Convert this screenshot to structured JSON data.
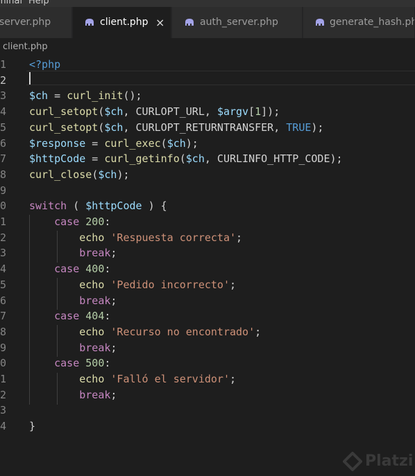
{
  "menubar": {
    "items": [
      "minal",
      "Help"
    ]
  },
  "tabs": [
    {
      "label": "server.php",
      "active": false,
      "icon": "php-elephant-icon"
    },
    {
      "label": "client.php",
      "active": true,
      "icon": "php-elephant-icon",
      "close": "×"
    },
    {
      "label": "auth_server.php",
      "active": false,
      "icon": "php-elephant-icon"
    },
    {
      "label": "generate_hash.php",
      "active": false,
      "icon": "php-elephant-icon"
    }
  ],
  "breadcrumb": "client.php",
  "editor": {
    "active_line": 2,
    "lines": [
      {
        "n": "1",
        "tokens": [
          [
            "<?php",
            "#569cd6"
          ]
        ]
      },
      {
        "n": "2",
        "tokens": []
      },
      {
        "n": "3",
        "tokens": [
          [
            "$ch",
            "#9cdcfe"
          ],
          [
            " = ",
            "#d4d4d4"
          ],
          [
            "curl_init",
            "#dcdcaa"
          ],
          [
            "();",
            "#d4d4d4"
          ]
        ]
      },
      {
        "n": "4",
        "tokens": [
          [
            "curl_setopt",
            "#dcdcaa"
          ],
          [
            "(",
            "#d4d4d4"
          ],
          [
            "$ch",
            "#9cdcfe"
          ],
          [
            ", CURLOPT_URL, ",
            "#d4d4d4"
          ],
          [
            "$argv",
            "#9cdcfe"
          ],
          [
            "[",
            "#d4d4d4"
          ],
          [
            "1",
            "#b5cea8"
          ],
          [
            "]);",
            "#d4d4d4"
          ]
        ]
      },
      {
        "n": "5",
        "tokens": [
          [
            "curl_setopt",
            "#dcdcaa"
          ],
          [
            "(",
            "#d4d4d4"
          ],
          [
            "$ch",
            "#9cdcfe"
          ],
          [
            ", CURLOPT_RETURNTRANSFER, ",
            "#d4d4d4"
          ],
          [
            "TRUE",
            "#569cd6"
          ],
          [
            ");",
            "#d4d4d4"
          ]
        ]
      },
      {
        "n": "6",
        "tokens": [
          [
            "$response",
            "#9cdcfe"
          ],
          [
            " = ",
            "#d4d4d4"
          ],
          [
            "curl_exec",
            "#dcdcaa"
          ],
          [
            "(",
            "#d4d4d4"
          ],
          [
            "$ch",
            "#9cdcfe"
          ],
          [
            ");",
            "#d4d4d4"
          ]
        ]
      },
      {
        "n": "7",
        "tokens": [
          [
            "$httpCode",
            "#9cdcfe"
          ],
          [
            " = ",
            "#d4d4d4"
          ],
          [
            "curl_getinfo",
            "#dcdcaa"
          ],
          [
            "(",
            "#d4d4d4"
          ],
          [
            "$ch",
            "#9cdcfe"
          ],
          [
            ", CURLINFO_HTTP_CODE);",
            "#d4d4d4"
          ]
        ]
      },
      {
        "n": "8",
        "tokens": [
          [
            "curl_close",
            "#dcdcaa"
          ],
          [
            "(",
            "#d4d4d4"
          ],
          [
            "$ch",
            "#9cdcfe"
          ],
          [
            ");",
            "#d4d4d4"
          ]
        ]
      },
      {
        "n": "9",
        "tokens": []
      },
      {
        "n": "0",
        "tokens": [
          [
            "switch",
            "#c586c0"
          ],
          [
            " ( ",
            "#d4d4d4"
          ],
          [
            "$httpCode",
            "#9cdcfe"
          ],
          [
            " ) {",
            "#d4d4d4"
          ]
        ]
      },
      {
        "n": "1",
        "tokens": [
          [
            "    ",
            "#d4d4d4"
          ],
          [
            "case",
            "#c586c0"
          ],
          [
            " ",
            "#d4d4d4"
          ],
          [
            "200",
            "#b5cea8"
          ],
          [
            ":",
            "#d4d4d4"
          ]
        ]
      },
      {
        "n": "2",
        "tokens": [
          [
            "        ",
            "#d4d4d4"
          ],
          [
            "echo",
            "#dcdcaa"
          ],
          [
            " ",
            "#d4d4d4"
          ],
          [
            "'Respuesta correcta'",
            "#ce9178"
          ],
          [
            ";",
            "#d4d4d4"
          ]
        ]
      },
      {
        "n": "3",
        "tokens": [
          [
            "        ",
            "#d4d4d4"
          ],
          [
            "break",
            "#c586c0"
          ],
          [
            ";",
            "#d4d4d4"
          ]
        ]
      },
      {
        "n": "4",
        "tokens": [
          [
            "    ",
            "#d4d4d4"
          ],
          [
            "case",
            "#c586c0"
          ],
          [
            " ",
            "#d4d4d4"
          ],
          [
            "400",
            "#b5cea8"
          ],
          [
            ":",
            "#d4d4d4"
          ]
        ]
      },
      {
        "n": "5",
        "tokens": [
          [
            "        ",
            "#d4d4d4"
          ],
          [
            "echo",
            "#dcdcaa"
          ],
          [
            " ",
            "#d4d4d4"
          ],
          [
            "'Pedido incorrecto'",
            "#ce9178"
          ],
          [
            ";",
            "#d4d4d4"
          ]
        ]
      },
      {
        "n": "6",
        "tokens": [
          [
            "        ",
            "#d4d4d4"
          ],
          [
            "break",
            "#c586c0"
          ],
          [
            ";",
            "#d4d4d4"
          ]
        ]
      },
      {
        "n": "7",
        "tokens": [
          [
            "    ",
            "#d4d4d4"
          ],
          [
            "case",
            "#c586c0"
          ],
          [
            " ",
            "#d4d4d4"
          ],
          [
            "404",
            "#b5cea8"
          ],
          [
            ":",
            "#d4d4d4"
          ]
        ]
      },
      {
        "n": "8",
        "tokens": [
          [
            "        ",
            "#d4d4d4"
          ],
          [
            "echo",
            "#dcdcaa"
          ],
          [
            " ",
            "#d4d4d4"
          ],
          [
            "'Recurso no encontrado'",
            "#ce9178"
          ],
          [
            ";",
            "#d4d4d4"
          ]
        ]
      },
      {
        "n": "9",
        "tokens": [
          [
            "        ",
            "#d4d4d4"
          ],
          [
            "break",
            "#c586c0"
          ],
          [
            ";",
            "#d4d4d4"
          ]
        ]
      },
      {
        "n": "0",
        "tokens": [
          [
            "    ",
            "#d4d4d4"
          ],
          [
            "case",
            "#c586c0"
          ],
          [
            " ",
            "#d4d4d4"
          ],
          [
            "500",
            "#b5cea8"
          ],
          [
            ":",
            "#d4d4d4"
          ]
        ]
      },
      {
        "n": "1",
        "tokens": [
          [
            "        ",
            "#d4d4d4"
          ],
          [
            "echo",
            "#dcdcaa"
          ],
          [
            " ",
            "#d4d4d4"
          ],
          [
            "'Falló el servidor'",
            "#ce9178"
          ],
          [
            ";",
            "#d4d4d4"
          ]
        ]
      },
      {
        "n": "2",
        "tokens": [
          [
            "        ",
            "#d4d4d4"
          ],
          [
            "break",
            "#c586c0"
          ],
          [
            ";",
            "#d4d4d4"
          ]
        ]
      },
      {
        "n": "3",
        "tokens": []
      },
      {
        "n": "4",
        "tokens": [
          [
            "}",
            "#d4d4d4"
          ]
        ]
      }
    ]
  },
  "watermark": {
    "label": "Platzi"
  },
  "colors": {
    "editor_bg": "#1e1e1e",
    "tab_bg": "#2d2d2d",
    "php_icon": "#a3a3e8"
  }
}
